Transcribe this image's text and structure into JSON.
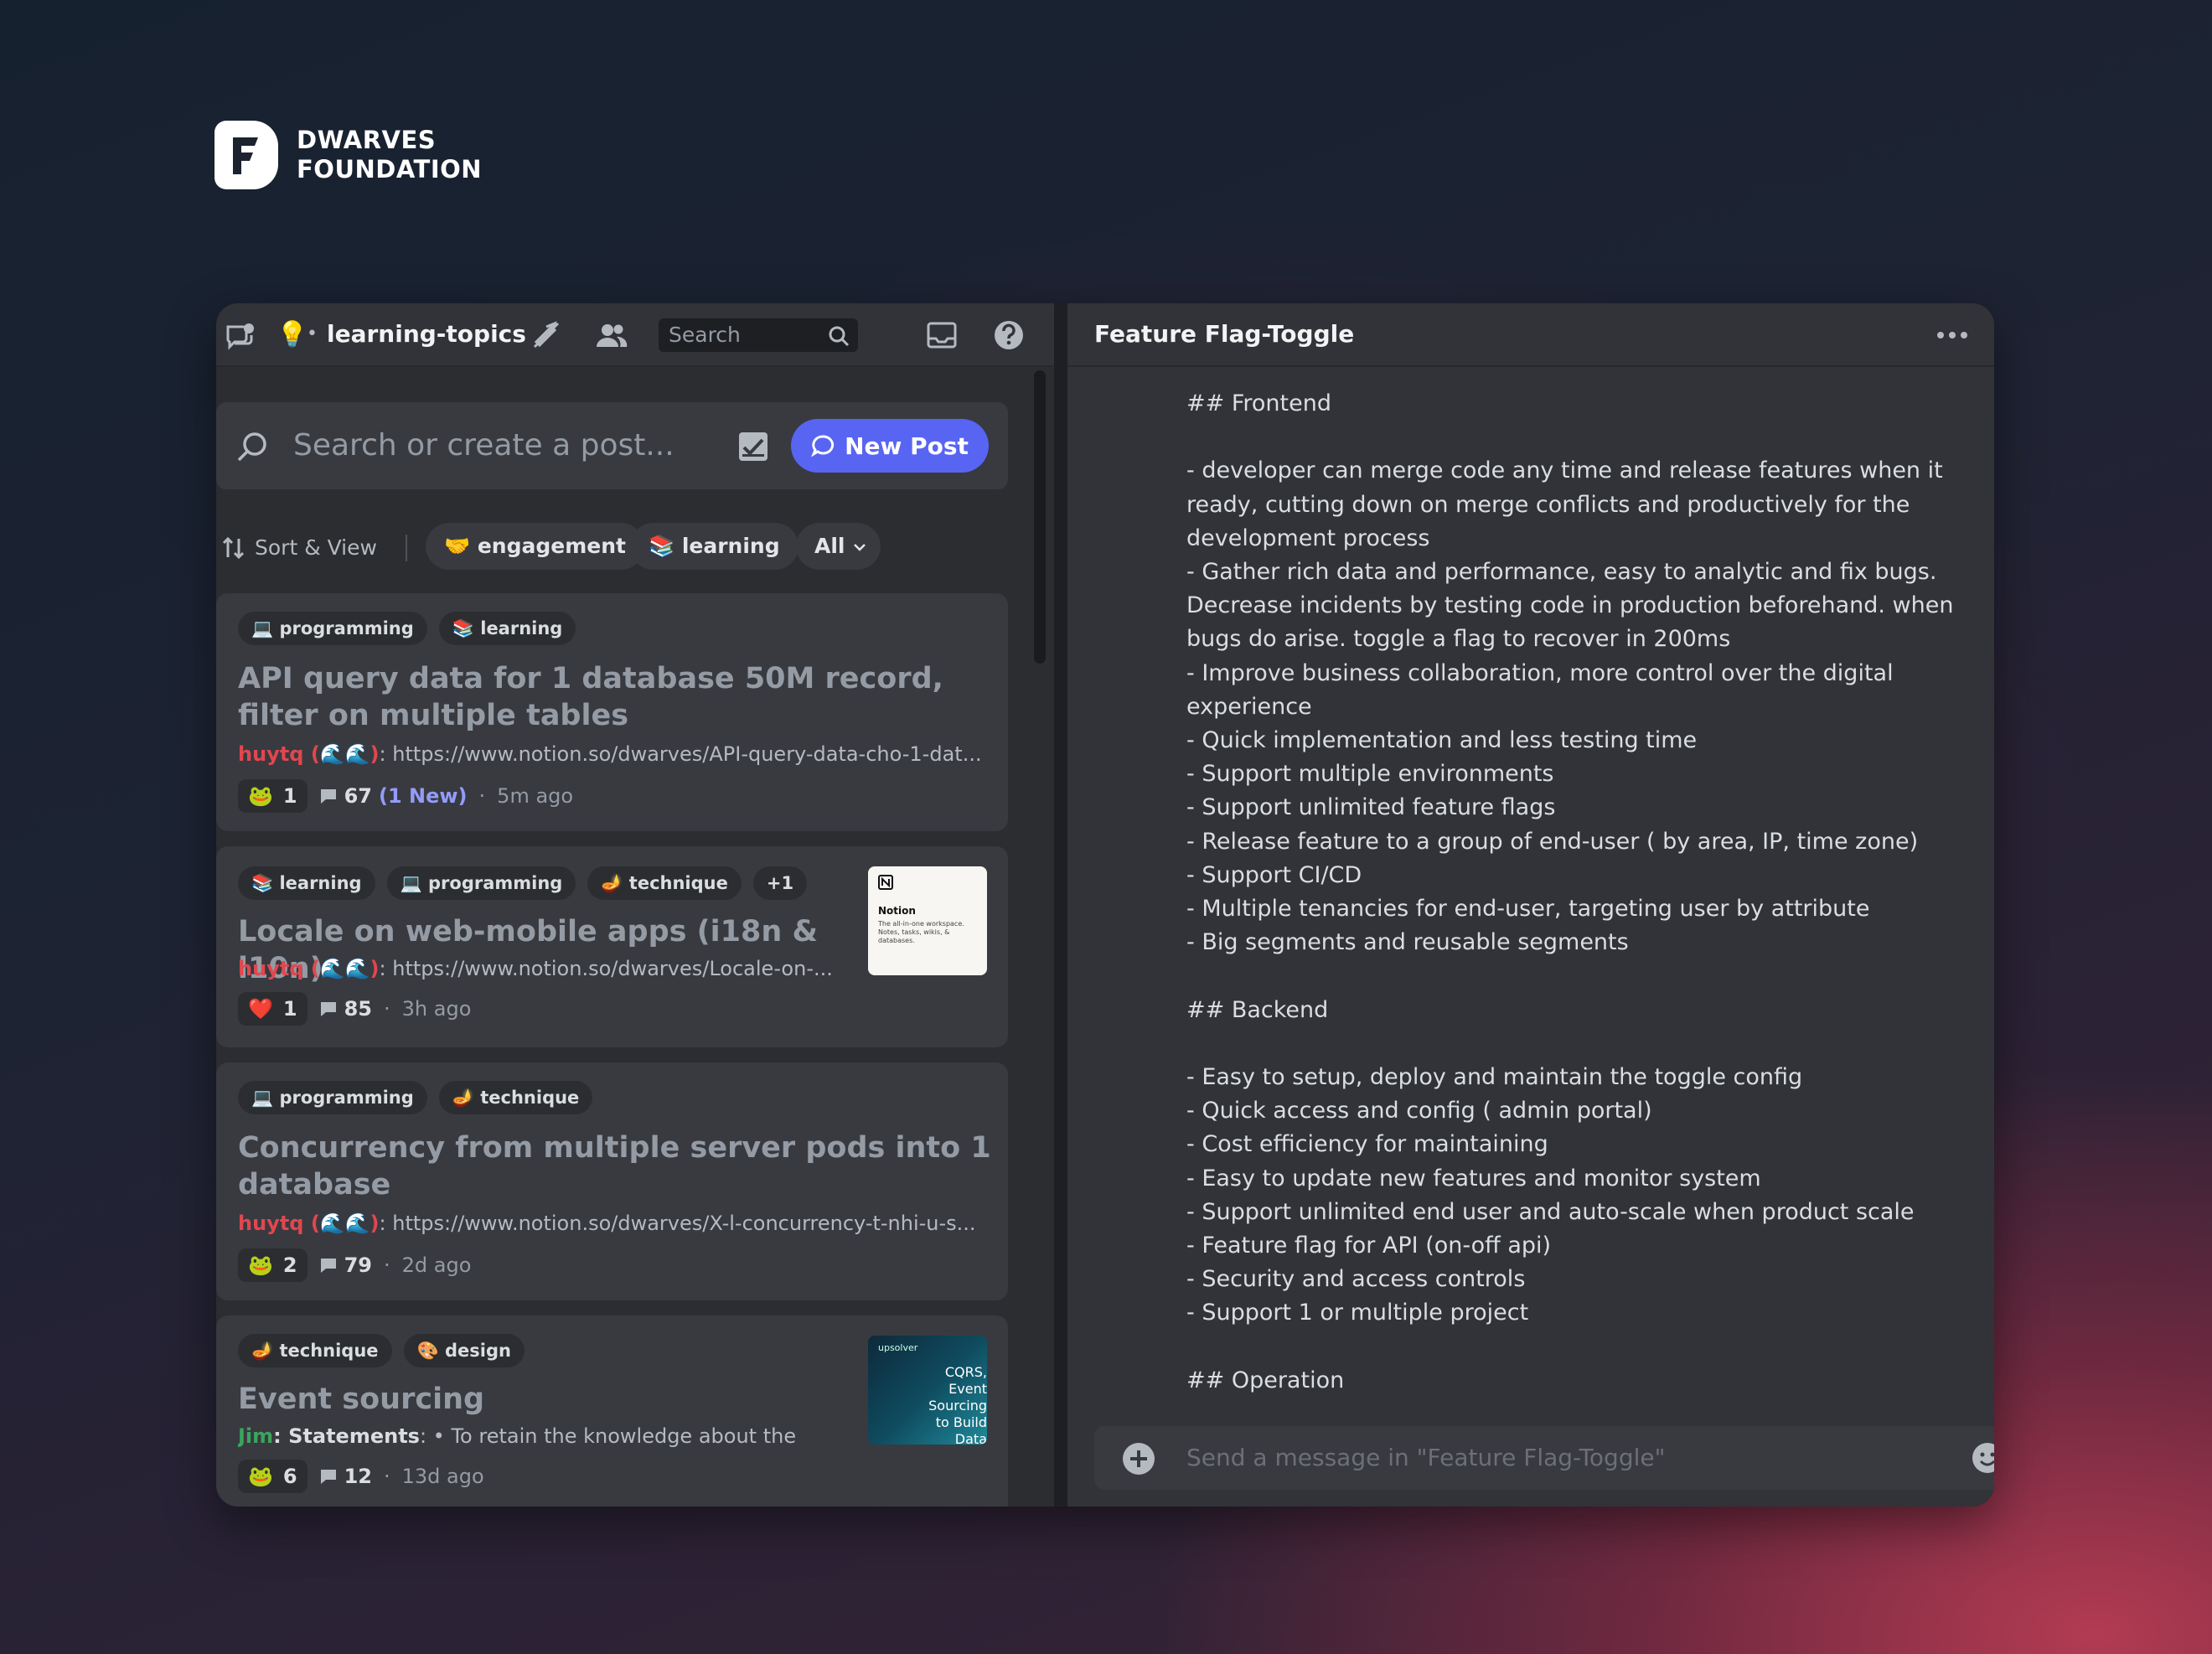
{
  "brand": {
    "line1": "DWARVES",
    "line2": "FOUNDATION"
  },
  "topbar": {
    "channel_name": "learning-topics",
    "channel_dot": "•",
    "search_placeholder": "Search"
  },
  "forum": {
    "search_placeholder": "Search or create a post...",
    "new_post_label": "New Post",
    "sort_view_label": "Sort & View",
    "filters": [
      "🤝 engagement",
      "📚 learning",
      "All"
    ]
  },
  "posts": [
    {
      "tags": [
        "💻 programming",
        "📚 learning"
      ],
      "title": "API query data for 1 database 50M record, filter on multiple tables",
      "author": "huytq (🌊🌊)",
      "snippet": ": https://www.notion.so/dwarves/API-query-data-cho-1-dat...",
      "reaction_count": "1",
      "message_count": "67",
      "new_count": "(1 New)",
      "time": "5m ago"
    },
    {
      "tags": [
        "📚 learning",
        "💻 programming",
        "🪔 technique",
        "+1"
      ],
      "title": "Locale on web-mobile apps (i18n & l10n)",
      "author": "huytq (🌊🌊)",
      "snippet": ": https://www.notion.so/dwarves/Locale-on-...",
      "reaction_count": "1",
      "message_count": "85",
      "time": "3h ago",
      "thumb_title": "Notion",
      "thumb_text": "The all-in-one workspace. Notes, tasks, wikis, & databases."
    },
    {
      "tags": [
        "💻 programming",
        "🪔 technique"
      ],
      "title": "Concurrency from multiple server pods into 1 database",
      "author": "huytq (🌊🌊)",
      "snippet": ": https://www.notion.so/dwarves/X-l-concurrency-t-nhi-u-s...",
      "reaction_count": "2",
      "message_count": "79",
      "time": "2d ago"
    },
    {
      "tags": [
        "🪔 technique",
        "🎨 design"
      ],
      "title": "Event sourcing",
      "author": "Jim",
      "snippet_bold": ": Statements",
      "snippet": ": • To retain the knowledge about the",
      "reaction_count": "6",
      "message_count": "12",
      "time": "13d ago",
      "thumb_brand": "upsolver",
      "thumb_text": "CQRS, Event Sourcing to Build Data Architecture"
    }
  ],
  "thread": {
    "title": "Feature Flag-Toggle",
    "body": "## Frontend\n\n- developer can merge code any time and release features when it ready, cutting down on merge conflicts and productively for the development process\n- Gather rich data and performance, easy to analytic and fix bugs. Decrease incidents by testing code in production beforehand. when bugs do arise. toggle a flag to recover in 200ms\n- Improve business collaboration, more control over the digital experience\n- Quick implementation and less testing time\n- Support multiple environments\n- Support unlimited feature flags\n- Release feature to a group of end-user ( by area, IP, time zone)\n- Support CI/CD\n- Multiple tenancies for end-user, targeting user by attribute\n- Big segments and reusable segments\n\n## Backend\n\n- Easy to setup, deploy and maintain the toggle config\n- Quick access and config ( admin portal)\n- Cost efficiency for maintaining\n- Easy to update new features and monitor system\n- Support unlimited end user and auto-scale when product scale\n- Feature flag for API (on-off api)\n- Security and access controls\n- Support 1 or multiple project\n\n## Operation",
    "composer_placeholder": "Send a message in \"Feature Flag-Toggle\""
  },
  "colors": {
    "accent": "#5865f2",
    "author_red": "#e0474f",
    "author_green": "#3ba55d",
    "new_count": "#949cf7"
  }
}
